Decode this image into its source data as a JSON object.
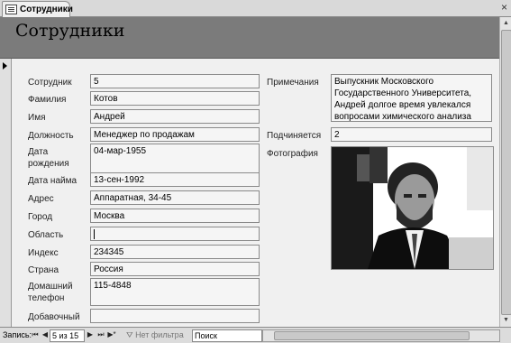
{
  "tab": {
    "label": "Сотрудники",
    "icon": "form-icon",
    "close": "×"
  },
  "form": {
    "title": "Сотрудники"
  },
  "fields": {
    "employee_id": {
      "label": "Сотрудник",
      "value": "5"
    },
    "last_name": {
      "label": "Фамилия",
      "value": "Котов"
    },
    "first_name": {
      "label": "Имя",
      "value": "Андрей"
    },
    "position": {
      "label": "Должность",
      "value": "Менеджер по продажам"
    },
    "birth_date": {
      "label": "Дата рождения",
      "value": "04-мар-1955"
    },
    "hire_date": {
      "label": "Дата найма",
      "value": "13-сен-1992"
    },
    "address": {
      "label": "Адрес",
      "value": "Аппаратная, 34-45"
    },
    "city": {
      "label": "Город",
      "value": "Москва"
    },
    "region": {
      "label": "Область",
      "value": ""
    },
    "postal_code": {
      "label": "Индекс",
      "value": "234345"
    },
    "country": {
      "label": "Страна",
      "value": "Россия"
    },
    "home_phone": {
      "label": "Домашний телефон",
      "value": "115-4848"
    },
    "extension": {
      "label": "Добавочный",
      "value": ""
    },
    "notes": {
      "label": "Примечания",
      "value": "Выпускник Московского Государственного Университета, Андрей долгое время увлекался вопросами химического анализа"
    },
    "reports_to": {
      "label": "Подчиняется",
      "value": "2"
    },
    "photo": {
      "label": "Фотография"
    }
  },
  "statusbar": {
    "record_label": "Запись:",
    "record_value": "5 из 15",
    "filter_label": "Нет фильтра",
    "search_placeholder": "Поиск",
    "nav_icons": [
      "first-record-icon",
      "prev-record-icon",
      "next-record-icon",
      "last-record-icon",
      "new-record-icon"
    ]
  },
  "colors": {
    "header_bg": "#7b7b7b",
    "background": "#f0f0f0",
    "field_border": "#8a8a8a"
  }
}
